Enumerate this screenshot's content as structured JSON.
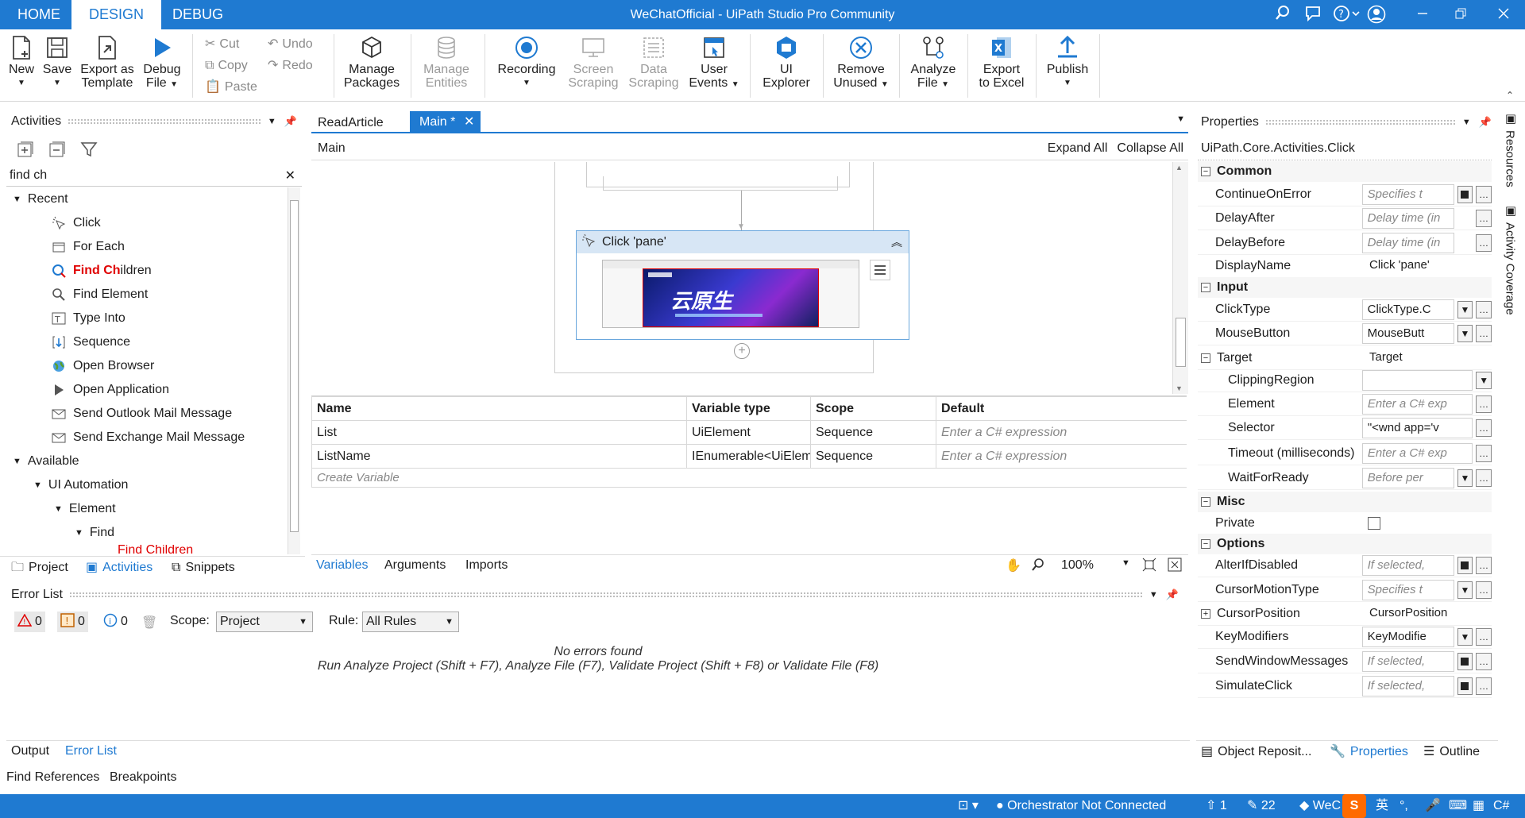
{
  "window": {
    "title": "WeChatOfficial - UiPath Studio Pro Community"
  },
  "menu_tabs": [
    {
      "label": "HOME"
    },
    {
      "label": "DESIGN"
    },
    {
      "label": "DEBUG"
    }
  ],
  "ribbon": {
    "new": "New",
    "save": "Save",
    "export_template_1": "Export as",
    "export_template_2": "Template",
    "debug_1": "Debug",
    "debug_2": "File",
    "cut": "Cut",
    "copy": "Copy",
    "paste": "Paste",
    "undo": "Undo",
    "redo": "Redo",
    "manage_packages_1": "Manage",
    "manage_packages_2": "Packages",
    "manage_entities_1": "Manage",
    "manage_entities_2": "Entities",
    "recording": "Recording",
    "screen_scraping_1": "Screen",
    "screen_scraping_2": "Scraping",
    "data_scraping_1": "Data",
    "data_scraping_2": "Scraping",
    "user_events_1": "User",
    "user_events_2": "Events",
    "ui_explorer_1": "UI",
    "ui_explorer_2": "Explorer",
    "remove_unused_1": "Remove",
    "remove_unused_2": "Unused",
    "analyze_file_1": "Analyze",
    "analyze_file_2": "File",
    "export_excel_1": "Export",
    "export_excel_2": "to Excel",
    "publish": "Publish"
  },
  "activities": {
    "title": "Activities",
    "search": "find ch",
    "recent_label": "Recent",
    "recent": [
      {
        "label": "Click"
      },
      {
        "label": "For Each"
      },
      {
        "label": "Find Children"
      },
      {
        "label": "Find Element"
      },
      {
        "label": "Type Into"
      },
      {
        "label": "Sequence"
      },
      {
        "label": "Open Browser"
      },
      {
        "label": "Open Application"
      },
      {
        "label": "Send Outlook Mail Message"
      },
      {
        "label": "Send Exchange Mail Message"
      }
    ],
    "available_label": "Available",
    "ui_automation": "UI Automation",
    "element": "Element",
    "find": "Find",
    "partial": "Find Children",
    "highlight": "Find Ch",
    "rest": "ildren"
  },
  "left_tabs": {
    "project": "Project",
    "activities": "Activities",
    "snippets": "Snippets"
  },
  "doc_tabs": [
    {
      "label": "ReadArticle"
    },
    {
      "label": "Main *"
    }
  ],
  "designer": {
    "breadcrumb": "Main",
    "expand_all": "Expand All",
    "collapse_all": "Collapse All",
    "activity_title": "Click 'pane'",
    "image_text": "云原生"
  },
  "variables": {
    "headers": [
      "Name",
      "Variable type",
      "Scope",
      "Default"
    ],
    "rows": [
      {
        "name": "List",
        "type": "UiElement",
        "scope": "Sequence",
        "default": "Enter a C# expression"
      },
      {
        "name": "ListName",
        "type": "IEnumerable<UiEleme",
        "scope": "Sequence",
        "default": "Enter a C# expression"
      }
    ],
    "create": "Create Variable"
  },
  "designer_tabs": {
    "variables": "Variables",
    "arguments": "Arguments",
    "imports": "Imports",
    "zoom": "100%"
  },
  "error_list": {
    "title": "Error List",
    "errors": "0",
    "warnings": "0",
    "infos": "0",
    "scope_label": "Scope:",
    "scope_value": "Project",
    "rule_label": "Rule:",
    "rule_value": "All Rules",
    "empty1": "No errors found",
    "empty2": "Run Analyze Project (Shift + F7), Analyze File (F7), Validate Project (Shift + F8) or Validate File (F8)"
  },
  "output_tabs": {
    "output": "Output",
    "error_list": "Error List"
  },
  "footer_tabs": {
    "find_refs": "Find References",
    "breakpoints": "Breakpoints"
  },
  "properties": {
    "title": "Properties",
    "type": "UiPath.Core.Activities.Click",
    "common": "Common",
    "input": "Input",
    "misc": "Misc",
    "options": "Options",
    "continue_on_error": "ContinueOnError",
    "continue_val": "Specifies t",
    "delay_after": "DelayAfter",
    "delay_after_val": "Delay time (in",
    "delay_before": "DelayBefore",
    "delay_before_val": "Delay time (in",
    "display_name": "DisplayName",
    "display_val": "Click 'pane'",
    "click_type": "ClickType",
    "click_type_val": "ClickType.C",
    "mouse_button": "MouseButton",
    "mouse_button_val": "MouseButt",
    "target": "Target",
    "target_val": "Target",
    "clipping": "ClippingRegion",
    "element": "Element",
    "element_val": "Enter a C# exp",
    "selector": "Selector",
    "selector_val": "\"<wnd app='v",
    "timeout": "Timeout (milliseconds)",
    "timeout_val": "Enter a C# exp",
    "wait_ready": "WaitForReady",
    "wait_ready_val": "Before per",
    "private": "Private",
    "alter": "AlterIfDisabled",
    "alter_val": "If selected,",
    "cursor_motion": "CursorMotionType",
    "cursor_motion_val": "Specifies t",
    "cursor_pos": "CursorPosition",
    "cursor_pos_val": "CursorPosition",
    "key_mod": "KeyModifiers",
    "key_mod_val": "KeyModifie",
    "send_window": "SendWindowMessages",
    "send_window_val": "If selected,",
    "simulate": "SimulateClick",
    "simulate_val": "If selected,"
  },
  "right_tabs": {
    "object_repo": "Object Reposit...",
    "properties": "Properties",
    "outline": "Outline"
  },
  "side_tabs": {
    "resources": "Resources",
    "coverage": "Activity Coverage"
  },
  "status": {
    "orchestrator": "Orchestrator Not Connected",
    "up": "1",
    "edit": "22",
    "wechat": "WeC",
    "ime": "英",
    "lang": "C#"
  },
  "colors": {
    "accent": "#1f7ad1",
    "error_red": "#e00000"
  }
}
